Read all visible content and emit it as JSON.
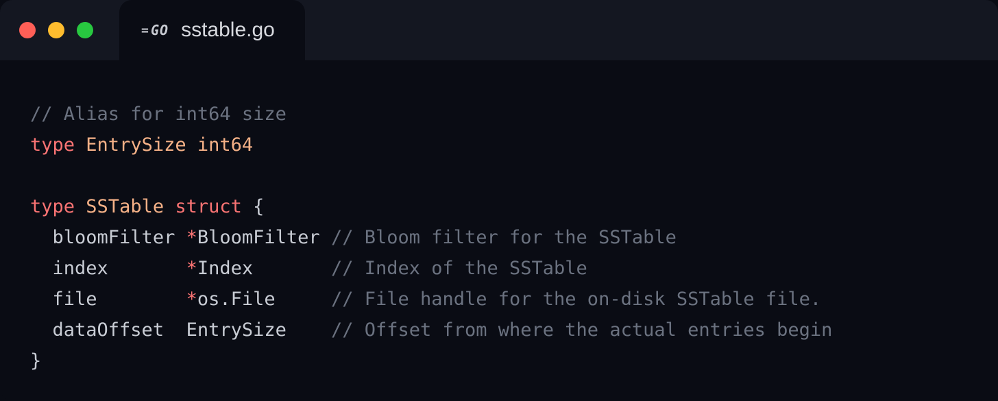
{
  "tab": {
    "filename": "sstable.go",
    "language_icon": "go-icon"
  },
  "code": {
    "l1": {
      "comment": "// Alias for int64 size"
    },
    "l2": {
      "kw_type": "type",
      "name": "EntrySize",
      "base": "int64"
    },
    "l3": {
      "blank": ""
    },
    "l4": {
      "kw_type": "type",
      "name": "SSTable",
      "kw_struct": "struct",
      "brace": "{"
    },
    "l5": {
      "field": "bloomFilter",
      "star": "*",
      "type": "BloomFilter",
      "comment": "// Bloom filter for the SSTable"
    },
    "l6": {
      "field": "index",
      "star": "*",
      "type": "Index",
      "comment": "// Index of the SSTable"
    },
    "l7": {
      "field": "file",
      "star": "*",
      "type": "os.File",
      "comment": "// File handle for the on-disk SSTable file."
    },
    "l8": {
      "field": "dataOffset",
      "type": "EntrySize",
      "comment": "// Offset from where the actual entries begin"
    },
    "l9": {
      "brace": "}"
    }
  }
}
